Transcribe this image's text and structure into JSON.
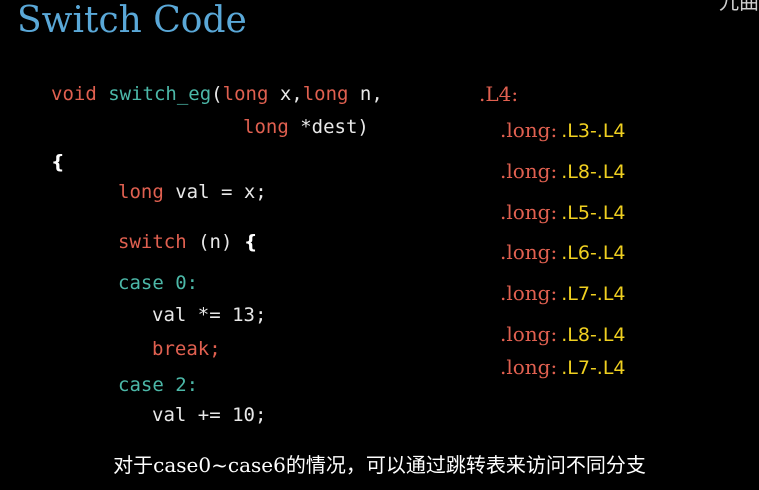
{
  "slide": {
    "title": "Switch Code",
    "corner_text": "九曲"
  },
  "code": {
    "line1": {
      "void": "void",
      "fn": "switch_eg",
      "p1": "(",
      "long1": "long",
      "p2": " x,",
      "long2": "long",
      "p3": " n,"
    },
    "line2": {
      "long": "long",
      "rest": " *dest)"
    },
    "open_brace": "{",
    "line3": {
      "long": "long",
      "rest": " val = x;"
    },
    "line4": {
      "switch": "switch",
      "rest": " (n)",
      "brace": "{"
    },
    "case0": "case 0:",
    "stmt0": "val *= 13;",
    "break0": "break;",
    "case2": "case 2:",
    "stmt2": "val += 10;"
  },
  "jump_table": {
    "label": ".L4:",
    "entries": [
      {
        "directive": ".long",
        "colon": ":",
        "target": ".L3-.L4"
      },
      {
        "directive": ".long",
        "colon": ":",
        "target": ".L8-.L4"
      },
      {
        "directive": ".long",
        "colon": ":",
        "target": ".L5-.L4"
      },
      {
        "directive": ".long",
        "colon": ":",
        "target": ".L6-.L4"
      },
      {
        "directive": ".long",
        "colon": ":",
        "target": ".L7-.L4"
      },
      {
        "directive": ".long",
        "colon": ":",
        "target": ".L8-.L4"
      },
      {
        "directive": ".long",
        "colon": ":",
        "target": ".L7-.L4"
      }
    ]
  },
  "subtitle": "对于case0~case6的情况，可以通过跳转表来访问不同分支",
  "colors": {
    "background": "#000000",
    "title": "#5aa8d8",
    "keyword_red": "#e06050",
    "keyword_teal": "#4cb8a8",
    "label_yellow": "#f0d020",
    "text": "#e8e8e8"
  }
}
